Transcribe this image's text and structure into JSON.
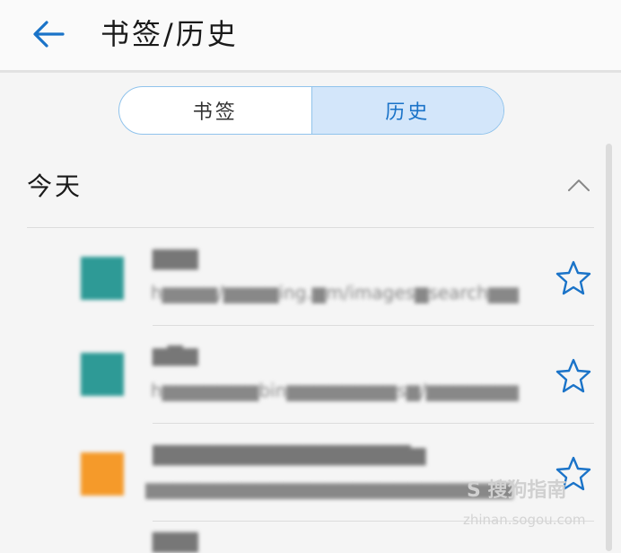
{
  "header": {
    "title": "书签/历史"
  },
  "segmented": {
    "tabs": [
      {
        "label": "书签"
      },
      {
        "label": "历史"
      }
    ],
    "active_tab": "历史"
  },
  "section": {
    "title": "今天"
  },
  "history": [
    {
      "title": "▇▇▇",
      "url": "h▆▆▆▆/▆▆▆▆ing.▆m/images▆search▆▆▆…",
      "favicon_color": "#2e9a96"
    },
    {
      "title": "▆▇▆",
      "url": "h▆▆▆▆▆▆▆bin▆▆▆▆▆▆▆▆s▆/▆▆▆▆▆▆▆v▆▆▆…",
      "favicon_color": "#2e9a96"
    },
    {
      "title": "▇▇▇▇▇▇▇▇▇▇▇▇▇▇▇▇▇▆",
      "url": "▆▆▆▆▆▆▆▆▆▆▆▆▆▆▆▆▆▆▆▆▆▆▆▆▆▆▆▆▆▆2F…",
      "favicon_color": "#f59a2a"
    },
    {
      "title": "▇▇▇",
      "url": ""
    }
  ],
  "watermark": {
    "text": "S 搜狗指南",
    "sub": "zhinan.sogou.com"
  },
  "colors": {
    "accent": "#1a73c8",
    "segment_active_bg": "#d3e6fa"
  }
}
